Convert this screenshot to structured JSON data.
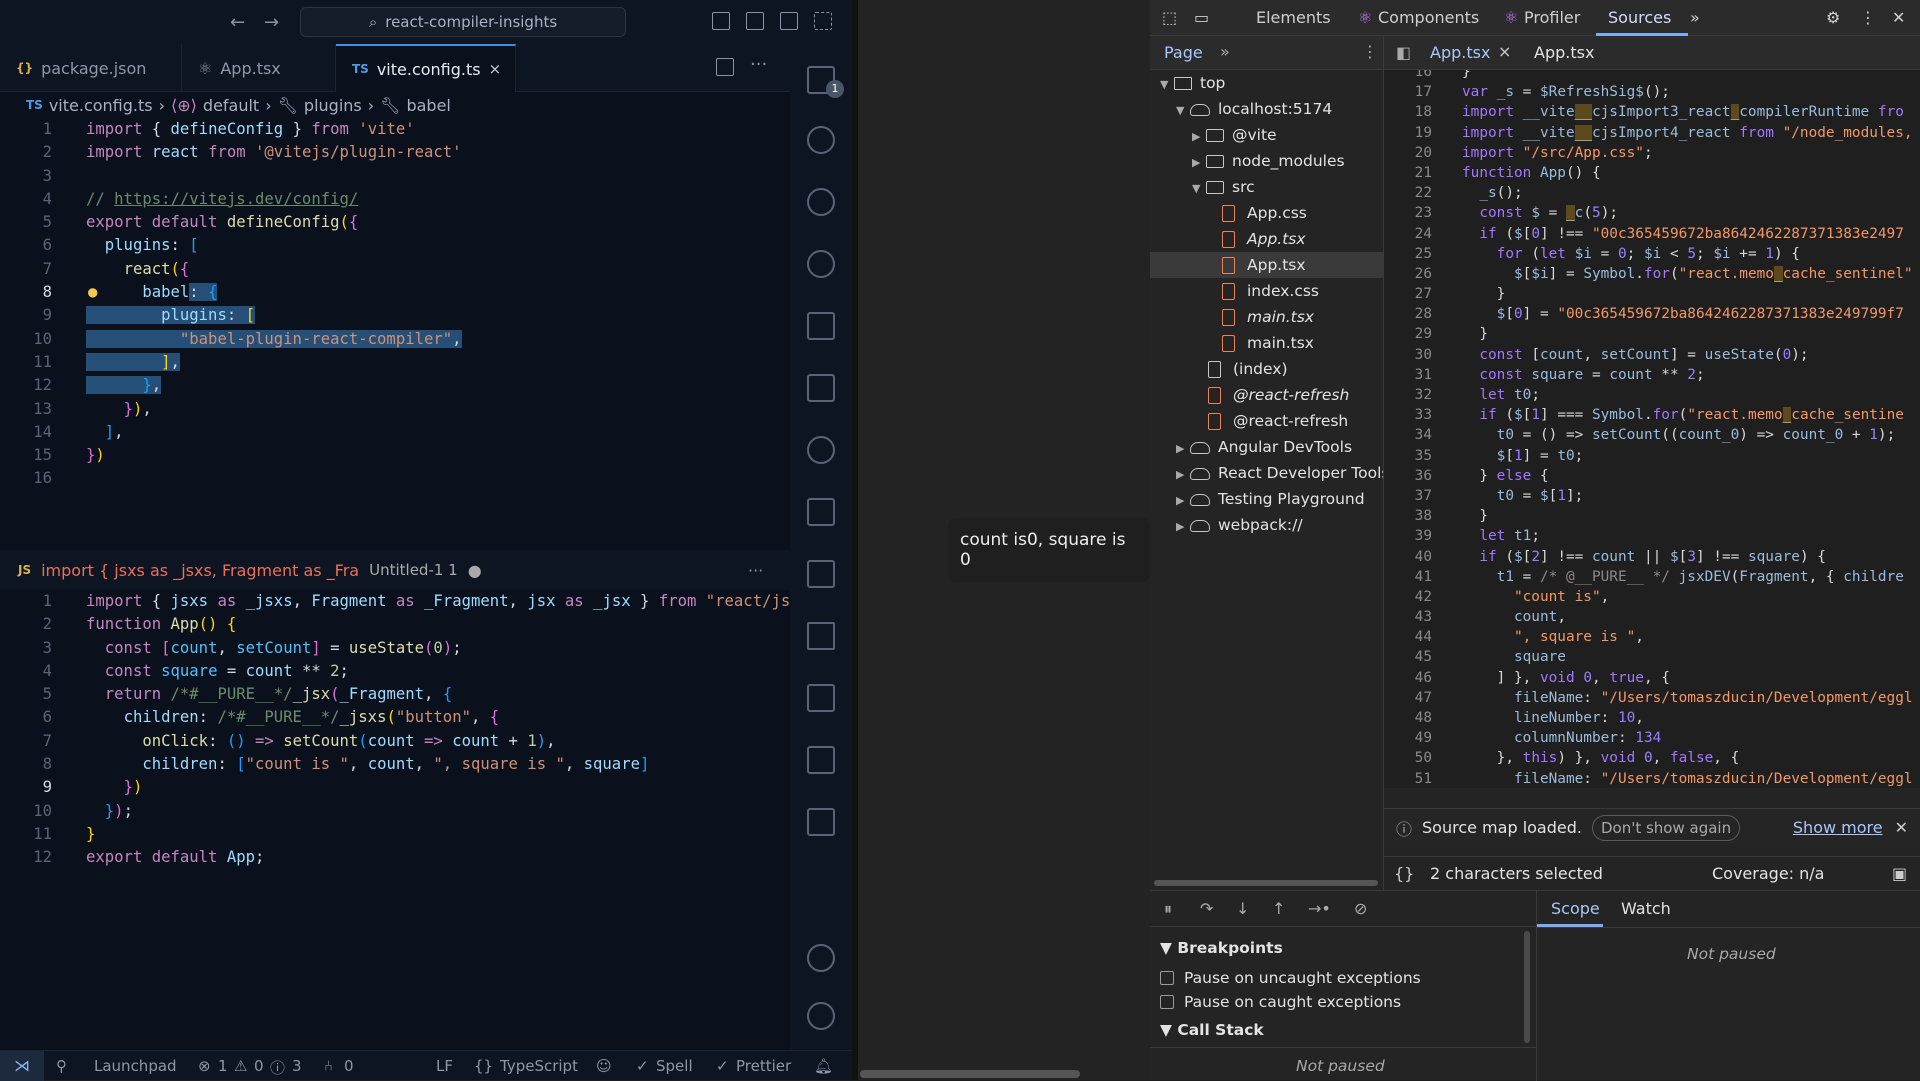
{
  "vscode": {
    "command_center": "react-compiler-insights",
    "tabs": [
      {
        "icon": "{}",
        "label": "package.json"
      },
      {
        "icon": "⚛",
        "label": "App.tsx"
      },
      {
        "icon": "TS",
        "label": "vite.config.ts",
        "close": "×"
      }
    ],
    "breadcrumb": {
      "file": "vite.config.ts",
      "items": [
        "default",
        "plugins",
        "babel"
      ]
    },
    "pane2": {
      "icon": "JS",
      "title": "import { jsxs as _jsxs, Fragment as _Fra",
      "file": "Untitled-1 1"
    },
    "activity_badge": "1",
    "status": {
      "branch": "Launchpad",
      "errors": "1",
      "warnings": "0",
      "info": "3",
      "ports": "0",
      "eol": "LF",
      "language": "TypeScript",
      "spell": "Spell",
      "prettier": "Prettier"
    }
  },
  "preview": {
    "button": "count is0, square is 0"
  },
  "devtools": {
    "tabs": [
      "Elements",
      "Components",
      "Profiler",
      "Sources"
    ],
    "active_tab": "Sources",
    "nav_head": "Page",
    "src_tabs": [
      "App.tsx",
      "App.tsx"
    ],
    "tree": [
      {
        "label": "top"
      },
      {
        "label": "localhost:5174"
      },
      {
        "label": "@vite"
      },
      {
        "label": "node_modules"
      },
      {
        "label": "src"
      },
      {
        "label": "App.css"
      },
      {
        "label": "App.tsx"
      },
      {
        "label": "App.tsx"
      },
      {
        "label": "index.css"
      },
      {
        "label": "main.tsx"
      },
      {
        "label": "main.tsx"
      },
      {
        "label": "(index)"
      },
      {
        "label": "@react-refresh"
      },
      {
        "label": "@react-refresh"
      },
      {
        "label": "Angular DevTools"
      },
      {
        "label": "React Developer Tools"
      },
      {
        "label": "Testing Playground"
      },
      {
        "label": "webpack://"
      }
    ],
    "sourcemap": {
      "msg": "Source map loaded.",
      "dismiss": "Don't show again",
      "more": "Show more"
    },
    "footer": {
      "selected": "2 characters selected",
      "coverage": "Coverage: n/a"
    },
    "scope_tabs": [
      "Scope",
      "Watch"
    ],
    "not_paused": "Not paused",
    "breakpoints": "Breakpoints",
    "pause_uncaught": "Pause on uncaught exceptions",
    "pause_caught": "Pause on caught exceptions",
    "call_stack": "Call Stack",
    "call_not_paused": "Not paused"
  }
}
